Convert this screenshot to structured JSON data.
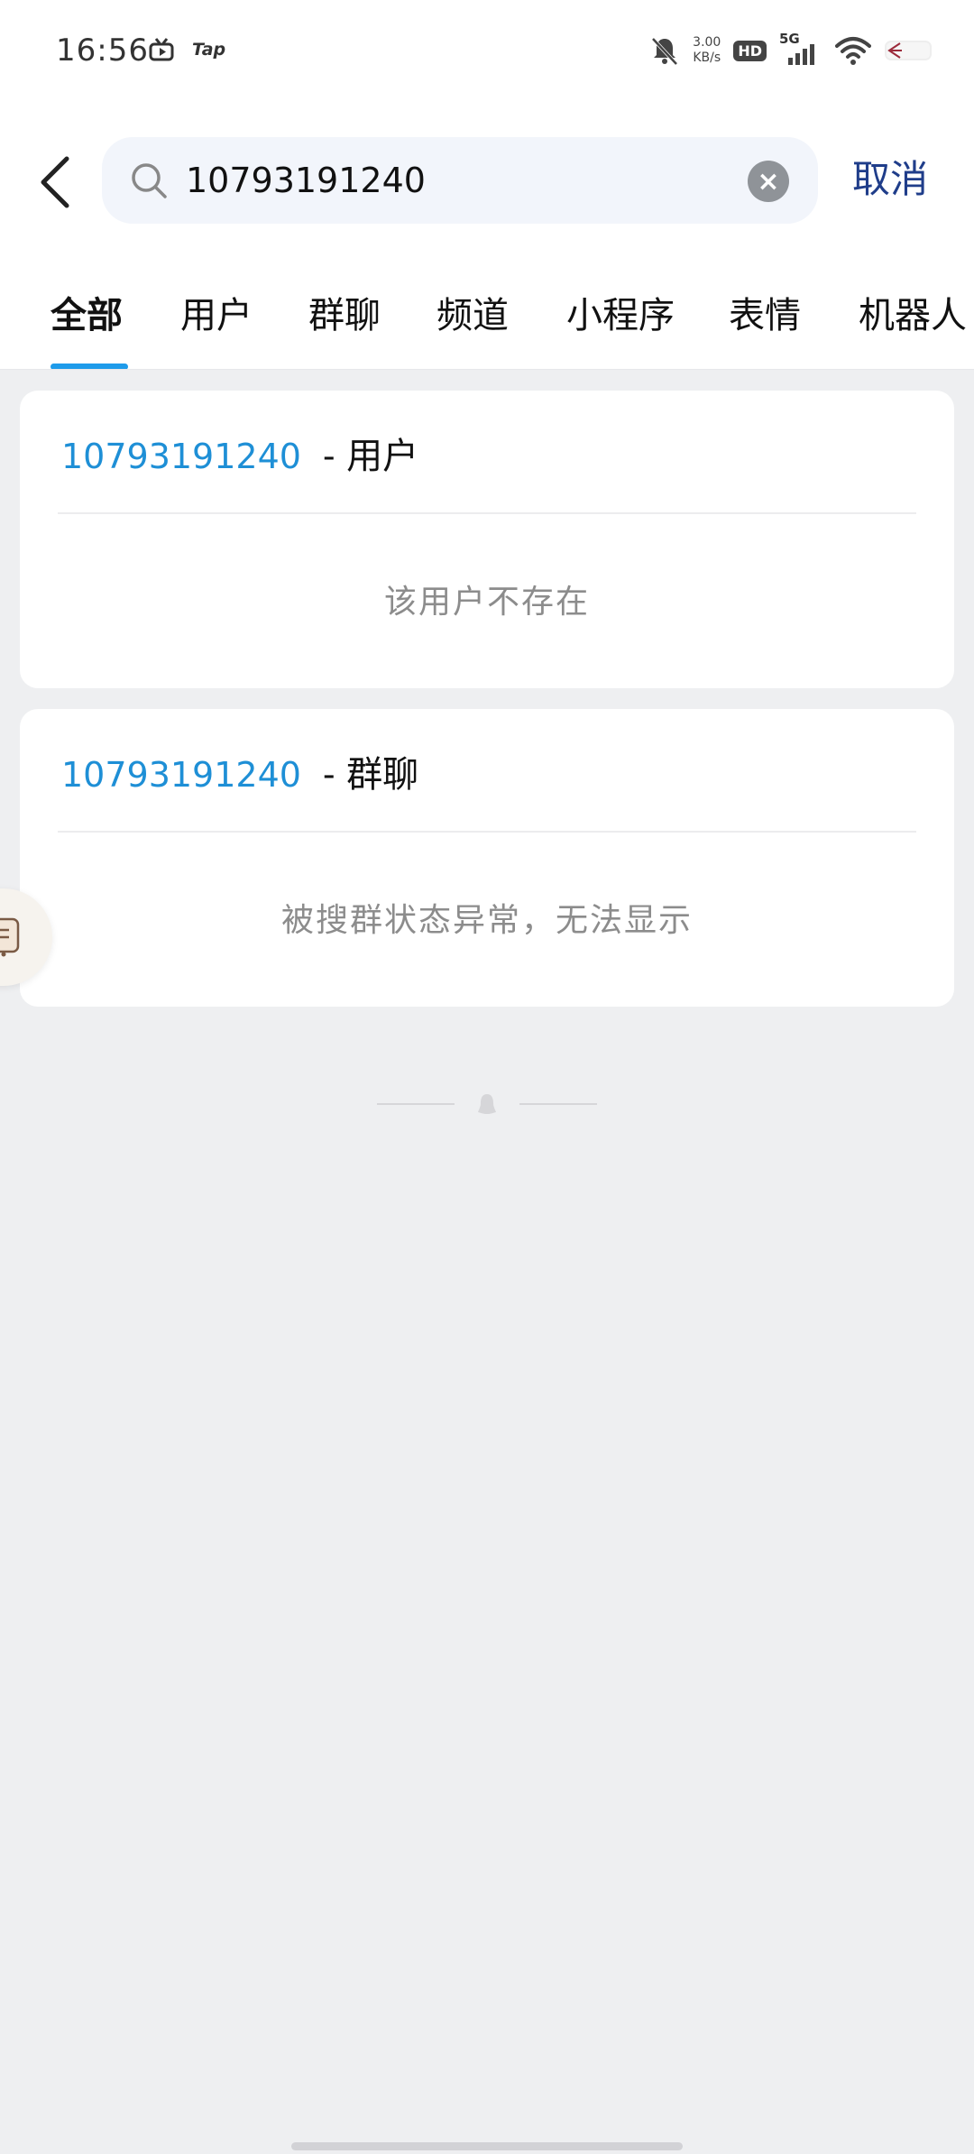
{
  "status_bar": {
    "time": "16:56",
    "tap_label": "Tap",
    "network_speed_value": "3.00",
    "network_speed_unit": "KB/s",
    "hd_label": "HD",
    "network_type": "5G"
  },
  "search": {
    "query": "10793191240",
    "cancel_label": "取消"
  },
  "tabs": [
    {
      "label": "全部",
      "active": true
    },
    {
      "label": "用户",
      "active": false
    },
    {
      "label": "群聊",
      "active": false
    },
    {
      "label": "频道",
      "active": false
    },
    {
      "label": "小程序",
      "active": false
    },
    {
      "label": "表情",
      "active": false
    },
    {
      "label": "机器人",
      "active": false
    }
  ],
  "results": [
    {
      "query": "10793191240",
      "category": "- 用户",
      "message": "该用户不存在"
    },
    {
      "query": "10793191240",
      "category": "- 群聊",
      "message": "被搜群状态异常，无法显示"
    }
  ],
  "colors": {
    "accent": "#1e9bea",
    "link": "#1e8fd6",
    "cancel": "#1f3d8a",
    "background": "#eeeff1"
  }
}
